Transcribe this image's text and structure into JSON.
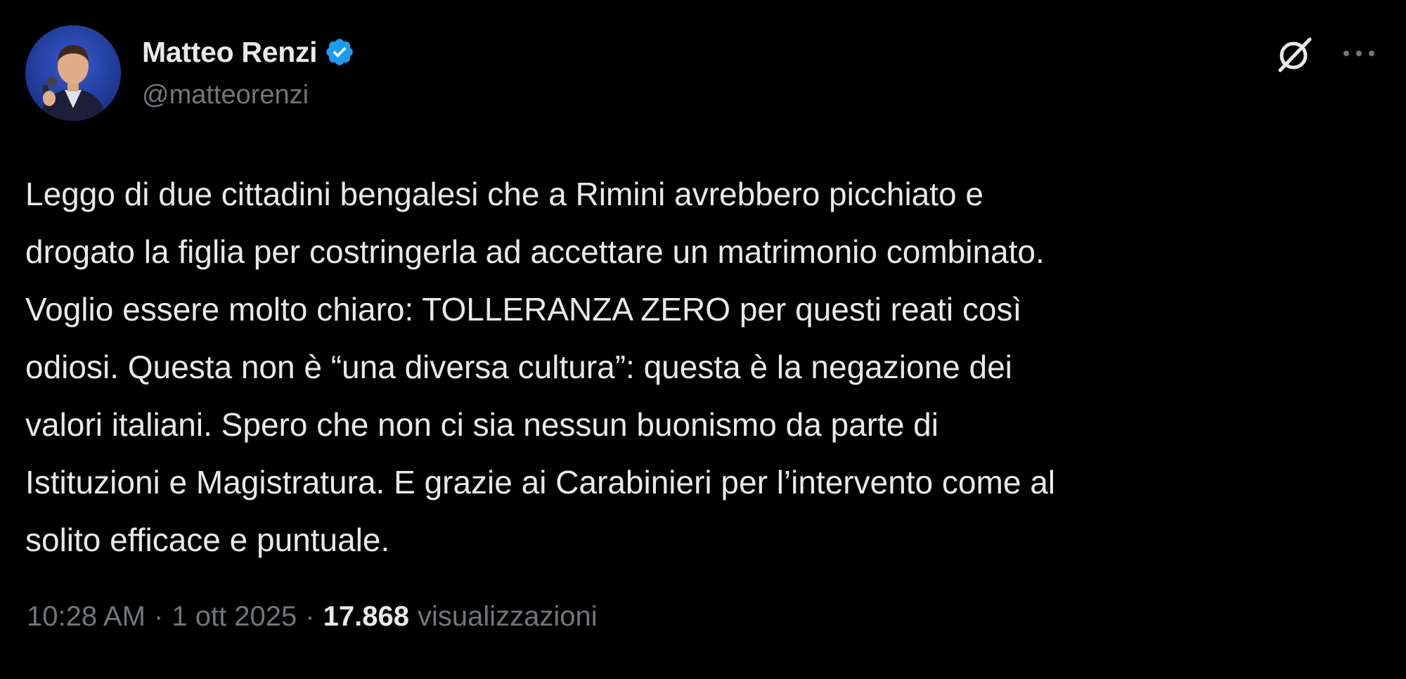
{
  "author": {
    "display_name": "Matteo Renzi",
    "handle": "@matteorenzi",
    "verified": true,
    "verified_color": "#1d9bf0"
  },
  "actions": {
    "grok_icon": "grok-icon",
    "more_icon": "more-options-icon"
  },
  "tweet": {
    "lines": [
      "Leggo di due cittadini bengalesi che a Rimini avrebbero picchiato e",
      "drogato la figlia per costringerla ad accettare un matrimonio combinato.",
      "Voglio essere molto chiaro: TOLLERANZA ZERO per questi reati così",
      "odiosi. Questa non è “una diversa cultura”: questa è la negazione dei",
      "valori italiani. Spero che non ci sia nessun buonismo da parte di",
      "Istituzioni e Magistratura. E grazie ai Carabinieri per l’intervento come al",
      "solito efficace e puntuale."
    ]
  },
  "meta": {
    "time": "10:28 AM",
    "separator": "·",
    "date": "1 ott 2025",
    "views_count": "17.868",
    "views_label": "visualizzazioni"
  },
  "colors": {
    "background": "#000000",
    "text_primary": "#e7e9ea",
    "text_secondary": "#71767b",
    "accent": "#1d9bf0"
  }
}
